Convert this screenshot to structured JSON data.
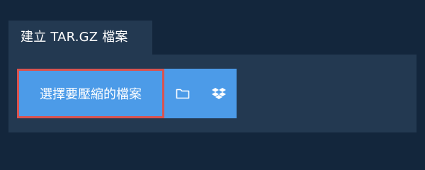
{
  "tab": {
    "label": "建立 TAR.GZ 檔案"
  },
  "upload": {
    "choose_label": "選擇要壓縮的檔案",
    "folder_icon": "folder-icon",
    "dropbox_icon": "dropbox-icon"
  },
  "colors": {
    "page_bg": "#13263c",
    "panel_bg": "#233951",
    "button_bg": "#4c9be8",
    "highlight_border": "#d9534f"
  }
}
